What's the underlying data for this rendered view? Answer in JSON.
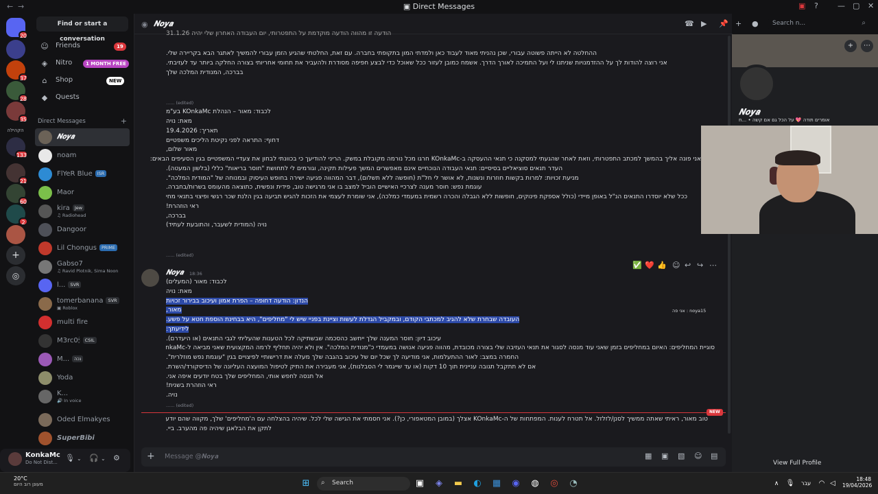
{
  "window": {
    "title": "Direct Messages"
  },
  "servers": [
    {
      "badge": "20"
    },
    {
      "badge": ""
    },
    {
      "badge": "37"
    },
    {
      "badge": "28"
    },
    {
      "badge": "35"
    },
    {
      "label": "הקהילה"
    },
    {
      "badge": "133"
    },
    {
      "badge": "21"
    },
    {
      "badge": "60"
    },
    {
      "badge": "2"
    },
    {
      "badge": ""
    }
  ],
  "sidebar": {
    "find_placeholder": "Find or start a conversation",
    "nav": [
      {
        "label": "Friends",
        "badge": "19"
      },
      {
        "label": "Nitro",
        "badge": "1 MONTH FREE"
      },
      {
        "label": "Shop",
        "badge": "NEW"
      },
      {
        "label": "Quests"
      }
    ],
    "dm_header": "Direct Messages",
    "dms": [
      {
        "name": "𝑵𝒐𝒚𝒂",
        "sub": "",
        "tag": ""
      },
      {
        "name": "noam",
        "sub": "",
        "tag": ""
      },
      {
        "name": "FlYeR Blue",
        "sub": "",
        "tag": "ISR"
      },
      {
        "name": "Maor",
        "sub": "",
        "tag": ""
      },
      {
        "name": "kira",
        "sub": "Radiohead",
        "tag": "Jew"
      },
      {
        "name": "Dangoor",
        "sub": "",
        "tag": ""
      },
      {
        "name": "Lil Chongus",
        "sub": "",
        "tag": "PRIME"
      },
      {
        "name": "Gabso7",
        "sub": "Ravid Plotnik, Sima Noon",
        "tag": ""
      },
      {
        "name": "l...",
        "sub": "",
        "tag": "SVR"
      },
      {
        "name": "tomerbanana",
        "sub": "Roblox",
        "tag": "SVR"
      },
      {
        "name": "multi fire",
        "sub": "",
        "tag": ""
      },
      {
        "name": "M3rc0🕯",
        "sub": "",
        "tag": "CSIL"
      },
      {
        "name": "M...",
        "sub": "",
        "tag": "נכה"
      },
      {
        "name": "Yoda",
        "sub": "",
        "tag": ""
      },
      {
        "name": "K...",
        "sub": "In voice",
        "tag": ""
      },
      {
        "name": "Oded Elmakyes",
        "sub": "",
        "tag": ""
      },
      {
        "name": "SuperBibi",
        "sub": "",
        "tag": ""
      }
    ]
  },
  "user": {
    "name": "KonkaMc",
    "status": "Do Not Dist..."
  },
  "chat": {
    "recipient": "𝑵𝒐𝒚𝒂",
    "search_placeholder": "Search n...",
    "top_lines": [
      "ההחלטה לא הייתה פשוטה עבורי, שכן נהניתי מאוד לעבוד כאן ולמדתי המון בתקופתי בחברה. עם זאת, החלטתי שהגיע הזמן עבורי להמשיך לאתגר הבא בקריירה שלי.",
      "אני רוצה להודות לך על ההזדמנויות שניתנו לי ועל התמיכה לאורך הדרך. אשמח כמובן לעזור ככל שאוכל כדי לבצע חפיפה מסודרת ולהעביר את תחומי אחריותי בצורה החלקה ביותר עד לעזיבתי.",
      "בברכה, המנודית המלכה שלך"
    ],
    "top_cut": "הודעה זו מהווה הודעה מוקדמת על התפטרותי, יום העבודה האחרון שלי יהיה 31.1.26",
    "edited": "(edited)",
    "letter_lines": [
      "לכבוד: מאור – הנהלת KOnkaMc בע\"מ",
      "מאת: נויה",
      "תאריך: 19.4.2026",
      "דחוף: התראה לפני נקיטת הליכים משפטיים",
      "מאור שלום,",
      "אני פונה אליך בהמשך למכתב התפטרותי, וזאת לאחר שהגעתי למסקנה כי תנאי ההעסקה ב-KOnkaMc חרגו מכל נורמה מקובלת במשק. הריני להודיעך כי בכוונתי לבחון את צעדיי המשפטיים בגין הסעיפים הבאים:",
      "העדר תנאים סוציאליים בסיסיים: תנאי העבודה הנוכחיים אינם מאפשרים המשך פעילות תקינה, וגורמים לי לתחושת \"חוסר בריאות\" כללי (בלשון המעטה).",
      "מניעת זכויות: למרות בקשות חוזרות ונשנות, לא אושר לי חל\"ת (חופשה ללא תשלום), דבר המהווה פגיעה ישירה בחופש העיסוק ובמנוחה של \"המודית המלכה\".",
      "עוגמת נפש: חוסר מענה לצרכיי האישיים הוביל למצב בו אני מרגישה טוב, פידית ונפשית, כתוצאה מהעומס בשרות/בחברה.",
      "ככל שלא יוסדרו התנאים הנ\"ל באופן מיידי (כולל אספקת פינוקים, חופשות ללא הגבלה והכרה רשמית במעמדי כמלכה), אני שומרת לעצמי את הזכות להגיש תביעה בגין הלנת שכר רגשי ופיצוי בתנאי מחיה.",
      "ראי הוזהרת!",
      "בברכה,",
      "נויה (המודית לשעבר, והתובעת לעתיד)"
    ],
    "last_author": "𝑵𝒐𝒚𝒂",
    "last_time": "18:36",
    "last_lines": [
      "לכבוד: מאור (המעלים)",
      "מאת: נויה",
      "הנדון: הודעה דחופה – הפרת אמון ועיכוב בבירור זכויות",
      "מאור,",
      "העובדה שבחרת שלא להגיב למכתבי הקודם, ובמקביל הגדלת לעשות וציינת בפניי שיש לי \"מחליפים\", היא בבחינת הוספת חטא על פשע.",
      "לידיעתך:",
      "עיכוב דיון: חוסר המענה שלך ייחשב כהסכמה שבשתיקה לכל הטענות שהעליתי לגבי התנאים (או היעדרם).",
      "סוגיית המחליפים: האיום במחליפים בזמן שאני עוד מנסה לסגור את תנאי העזיבה שלי בצורה מכובדת, מהווה פגיעה אנושה במעמדי כ\"מנודית המלכה\". אין ולא יהיה תחליף לרמה המקצועית שאני מביאה ל-KOnkaMc.",
      "החמרה במצב: לאור ההתעלמות, אני מודיעה לך שכל יום של עיכוב בהגבה שלך מעלה את דרישותיי לפיצויים בגין \"עוגמת נפש מוזלרית\".",
      "אם לא תתקבל תגובה עניינית תוך 10 דקות (או עד שייגמר לי הסבלנות), אני מעבירה את התיק לטיפול המועצה העליונה של הדיסקורד/השרת.",
      "אל תנסה לחפש אותי, המחליפים שלך בטח יודעים איפה אני.",
      "ראי הוזהרת בשנית!",
      "נויה."
    ],
    "new_label": "NEW",
    "new_message": "טוב מאור, ראיתי שאתה ממשיך לסנן/לזלזל. אל תטרח לענות. המפתחות של ה-KOnkaMc אצלך (במובן המטאפורי, כן?). אני חסמתי את הגישה שלי לכל. שיהיה בהצלחה עם ה'מחליפים' שלך, מקווה שהם יודעים",
    "new_message_2": "לתקן את הבלאגן שיהיה פה מהערב. ביי.",
    "input_placeholder": "Message @𝑵𝒐𝒚𝒂",
    "reactions": [
      "✅",
      "❤️",
      "👍"
    ]
  },
  "profile": {
    "name": "𝑵𝒐𝒚𝒂",
    "status": "אומרים תודה 💖 על הכל גם אם קשה • ...ח",
    "nametag": "אני פה : noya15",
    "view_full": "View Full Profile"
  },
  "taskbar": {
    "temp": "20°C",
    "weather": "מעונן רוב היום",
    "search": "Search",
    "lang": "עבר",
    "time": "18:48",
    "date": "19/04/2026"
  },
  "colors": {
    "accent": "#5865f2",
    "danger": "#da373c",
    "highlight": "#2d4aa8"
  }
}
